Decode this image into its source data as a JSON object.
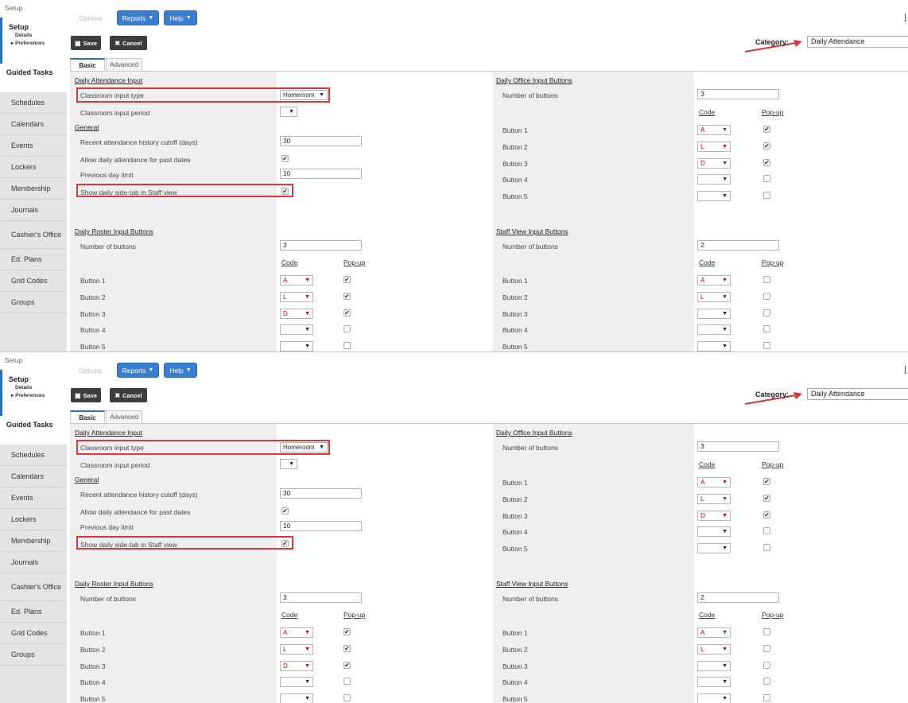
{
  "breadcrumb": "Setup",
  "sidebar": {
    "setup": {
      "title": "Setup",
      "details": "Details",
      "preferences": "▸ Preferences"
    },
    "guided": "Guided Tasks",
    "items": [
      "Schedules",
      "Calendars",
      "Events",
      "Lockers",
      "Membership",
      "Journals",
      "Cashier's Office",
      "Ed. Plans",
      "Grid Codes",
      "Groups"
    ]
  },
  "toolbar": {
    "options": "Options",
    "reports": "Reports",
    "help": "Help",
    "save": "Save",
    "cancel": "Cancel",
    "corner": "["
  },
  "category": {
    "label": "Category:",
    "value": "Daily Attendance"
  },
  "tabs": [
    "Basic",
    "Advanced"
  ],
  "left": {
    "daily_attendance_input": "Daily Attendance Input",
    "classroom_input_type": {
      "label": "Classroom input type",
      "value": "Homeroom"
    },
    "classroom_input_period": {
      "label": "Classroom input period",
      "value": ""
    },
    "general": "General",
    "history_cutoff": {
      "label": "Recent attendance history cutoff (days)",
      "value": "30"
    },
    "allow_past": {
      "label": "Allow daily attendance for past dates",
      "checked": true
    },
    "prev_day_limit": {
      "label": "Previous day limit",
      "value": "10"
    },
    "show_side_tab": {
      "label": "Show daily side-tab in Staff view",
      "checked": true
    },
    "roster": {
      "title": "Daily Roster Input Buttons",
      "num_label": "Number of buttons",
      "num_value": "3",
      "code_header": "Code",
      "popup_header": "Pop-up",
      "buttons": [
        {
          "label": "Button 1",
          "code": "A",
          "popup": true
        },
        {
          "label": "Button 2",
          "code": "L",
          "popup": true
        },
        {
          "label": "Button 3",
          "code": "D",
          "popup": true
        },
        {
          "label": "Button 4",
          "code": "",
          "popup": false
        },
        {
          "label": "Button 5",
          "code": "",
          "popup": false
        }
      ]
    }
  },
  "right": {
    "office": {
      "title": "Daily Office Input Buttons",
      "num_label": "Number of buttons",
      "num_value": "3",
      "code_header": "Code",
      "popup_header": "Pop-up",
      "buttons": [
        {
          "label": "Button 1",
          "code": "A",
          "popup": true
        },
        {
          "label": "Button 2",
          "code": "L",
          "popup": true
        },
        {
          "label": "Button 3",
          "code": "D",
          "popup": true
        },
        {
          "label": "Button 4",
          "code": "",
          "popup": false
        },
        {
          "label": "Button 5",
          "code": "",
          "popup": false
        }
      ]
    },
    "staff": {
      "title": "Staff View Input Buttons",
      "num_label": "Number of buttons",
      "num_value": "2",
      "code_header": "Code",
      "popup_header": "Pop-up",
      "buttons": [
        {
          "label": "Button 1",
          "code": "A",
          "popup": false
        },
        {
          "label": "Button 2",
          "code": "L",
          "popup": false
        },
        {
          "label": "Button 3",
          "code": "",
          "popup": false
        },
        {
          "label": "Button 4",
          "code": "",
          "popup": false
        },
        {
          "label": "Button 5",
          "code": "",
          "popup": false
        }
      ]
    }
  },
  "colors": {
    "accent": "#3a7fcf",
    "highlight": "#d9383a",
    "code_red": "#cc0000"
  },
  "icons": {
    "save": "floppy-icon",
    "cancel": "x-icon",
    "caret": "chevron-down-icon"
  }
}
